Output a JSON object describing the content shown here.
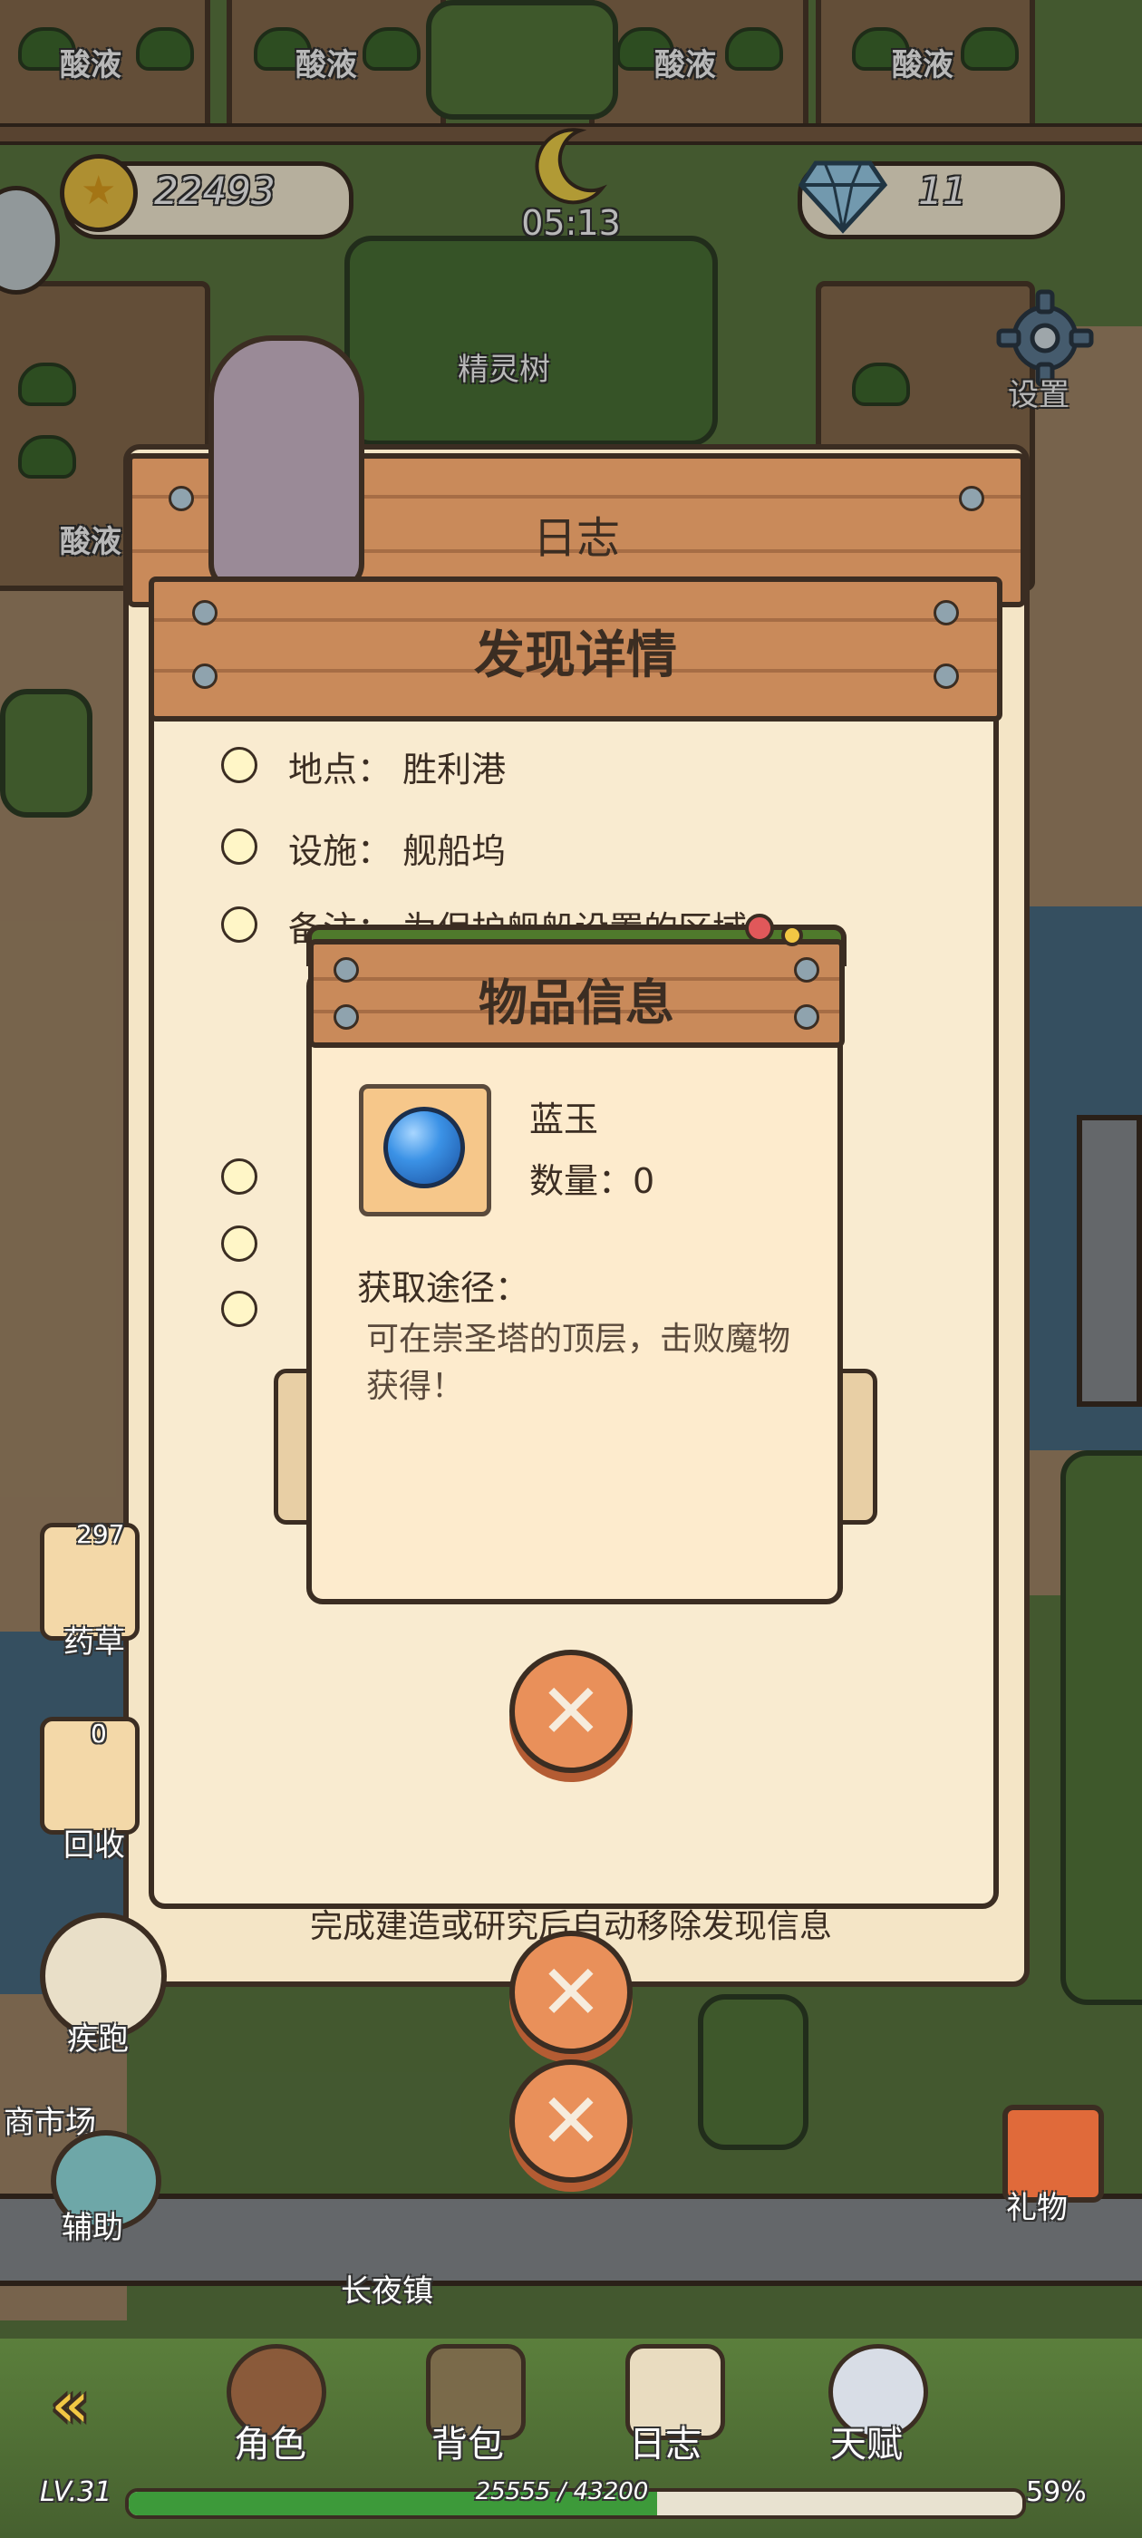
{
  "hud": {
    "coins": "22493",
    "gems": "11",
    "time": "05:13",
    "settings_label": "设置",
    "tree_label": "精灵树",
    "plot_label": "酸液"
  },
  "log_panel": {
    "title": "日志",
    "footer": "完成建造或研究后自动移除发现信息"
  },
  "discovery_panel": {
    "title": "发现详情",
    "rows": [
      {
        "label": "地点：",
        "value": "胜利港"
      },
      {
        "label": "设施：",
        "value": "舰船坞"
      },
      {
        "label": "备注：",
        "value": "为保护舰船设置的区域"
      }
    ]
  },
  "item_panel": {
    "title": "物品信息",
    "item_name": "蓝玉",
    "quantity": "数量：0",
    "source_label": "获取途径：",
    "source_text": "可在崇圣塔的顶层，击败魔物获得！"
  },
  "side_buttons": {
    "herb_count": "297",
    "herb_label": "药草",
    "recycle_count": "0",
    "recycle_label": "回收",
    "run_label": "疾跑",
    "market_label": "商市场",
    "assist_label": "辅助",
    "gift_label": "礼物",
    "town_label": "长夜镇"
  },
  "bottom_nav": {
    "character": "角色",
    "backpack": "背包",
    "journal": "日志",
    "talent": "天赋"
  },
  "status": {
    "level": "LV.31",
    "xp": "25555 / 43200",
    "xp_fraction": 0.5916,
    "percent": "59%"
  },
  "colors": {
    "wood": "#c98a5a",
    "parchment": "#f4e5c6",
    "close_button": "#e9905a",
    "xp_fill": "#3d9a3a"
  }
}
